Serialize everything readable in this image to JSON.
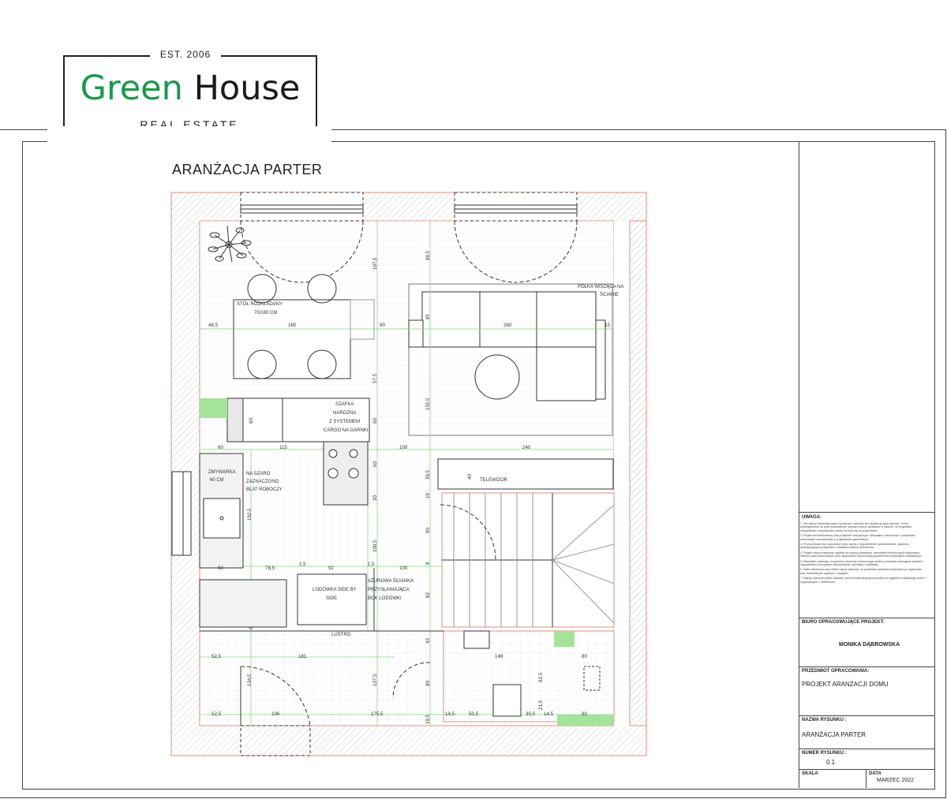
{
  "logo": {
    "est": "EST. 2006",
    "brand_green": "Green",
    "brand_black": "House",
    "sub": "REAL ESTATE",
    "green_color": "#149c4a"
  },
  "drawing": {
    "title": "ARANŻACJA PARTER",
    "labels": {
      "table": "STÓŁ ROZKŁADANY",
      "table_size": "70/160 CM",
      "shelf1": "PÓŁKA WISZĄCA NA",
      "shelf2": "ŚCIANIE",
      "cabinet1": "SZAFKA",
      "cabinet2": "NAROŻNA",
      "cabinet3": "Z SYSTEMEM",
      "cabinet4": "CARGO NA GARNKI",
      "dishwasher1": "ZMYWARKA",
      "dishwasher2": "60 CM",
      "worktop1": "NA SZARO",
      "worktop2": "ZAZNACZONO",
      "worktop3": "BLAT ROBOCZY",
      "fridge1": "LODÓWKA SIDE BY",
      "fridge2": "SIDE",
      "wall1": "AŻUROWA ŚCIANKA",
      "wall2": "PRZYSŁANIAJĄCA",
      "wall3": "BOK LODÓWKI",
      "tv": "TELEWIZOR",
      "mirror": "LUSTRO"
    },
    "dims_h": [
      "48,5",
      "160",
      "90",
      "260",
      "15",
      "60",
      "115",
      "100",
      "240",
      "60",
      "78,5",
      "1,5",
      "92",
      "1,5",
      "100",
      "52,5",
      "181",
      "149",
      "80",
      "52,5",
      "106",
      "175,5",
      "14,5",
      "50,5",
      "30,5",
      "14,5",
      "80"
    ],
    "dims_v": [
      "107,5",
      "88,5",
      "85",
      "57,5",
      "155,5",
      "60",
      "60",
      "39,5",
      "60",
      "30",
      "192,5",
      "19",
      "80",
      "100,5",
      "8",
      "82",
      "43",
      "134,5",
      "137,5",
      "80",
      "62,5",
      "21,5",
      "19,5",
      "40",
      "6"
    ]
  },
  "title_block": {
    "notes_heading": "UWAGA:",
    "notes": [
      "1. Nie należy schematyzować wymiarów z rysunku ani używać go jako dowodu. Przed przystąpieniem do prac budowlanych wymiary należy sprawdzić w naturze. W przypadku niezgodności niezgodności należy zwrócić się do projektanta.",
      "2. Projekt architektoniczny jest projektem nadrzędnym. Wszystkie rozbieżności z projektami branżowymi skonsultować z projektantem generalnym.",
      "3. Przed pracami być wykonane przez osoby z odpowiednimi uprawnieniami, zgodnie z obowiązującymi przepisami i zasadami wiedzy technicznej.",
      "4. Projekt należy traktować zgodnie ze sztuką budowlaną, warunkami technicznymi wykonania i odbioru robót budowlanych oraz wytycznymi i technologią producentów materiałów budowlanych.",
      "5. Wszystkie materiały, urządzenia, elementy i technologie powinny posiadać wymagane prawem i odpowiednimi przepisami dopuszczenia, aprobaty i certyfikaty.",
      "6. Stała zabudowa oraz meble należy wykonać na podstawie pomiarów pobranych po wykonaniu prac budowlanych zgodnie z uwagami.",
      "7. Należy wykonać próbki okładzin, przed konstrukcyjnymi pracami za wyjątkiem zapisanego przez i uzgodnionych z inwestorem."
    ],
    "office_label": "BIURO OPRACOWUJĄCE PROJEKT:",
    "office": "MONIKA DĄBROWSKA",
    "subject_label": "PRZEDMIOT OPRACOWANIA:",
    "subject": "PROJEKT ARANŻACJI DOMU",
    "drawing_name_label": "NAZWA RYSUNKU :",
    "drawing_name": "ARANŻACJA PARTER",
    "drawing_no_label": "NUMER RYSUNKU :",
    "drawing_no": "0.1",
    "scale_label": "SKALA",
    "date_label": "DATA",
    "date": "MARZEC 2022"
  }
}
